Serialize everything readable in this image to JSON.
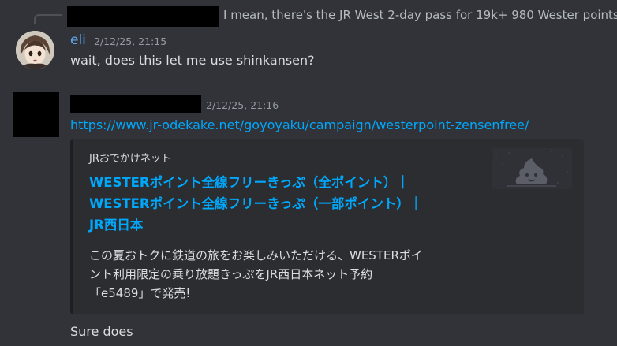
{
  "reply": {
    "text": "I mean, there's the JR West 2-day pass for 19k+ 980 Wester points"
  },
  "message1": {
    "username": "eli",
    "timestamp": "2/12/25, 21:15",
    "text": "wait, does this let me use shinkansen?"
  },
  "message2": {
    "timestamp": "2/12/25, 21:16",
    "link": "https://www.jr-odekake.net/goyoyaku/campaign/westerpoint-zensenfree/",
    "embed": {
      "provider": "JRおでかけネット",
      "title_line1": "WESTERポイント全線フリーきっぷ（全ポイント）｜",
      "title_line2": "WESTERポイント全線フリーきっぷ（一部ポイント）｜",
      "title_line3": "JR西日本",
      "desc_line1": "この夏おトクに鉄道の旅をお楽しみいただける、WESTERポイ",
      "desc_line2": "ント利用限定の乗り放題きっぷをJR西日本ネット予約",
      "desc_line3": "「e5489」で発売!"
    },
    "followup": "Sure does"
  },
  "colors": {
    "background": "#313338",
    "link": "#00a8fc",
    "username_eli": "#5fa8f0",
    "embed_bg": "#2b2d31",
    "muted": "#949ba4"
  },
  "icons": {
    "avatar_eli": "anime-avatar",
    "embed_thumbnail": "poop-mascot-icon"
  }
}
